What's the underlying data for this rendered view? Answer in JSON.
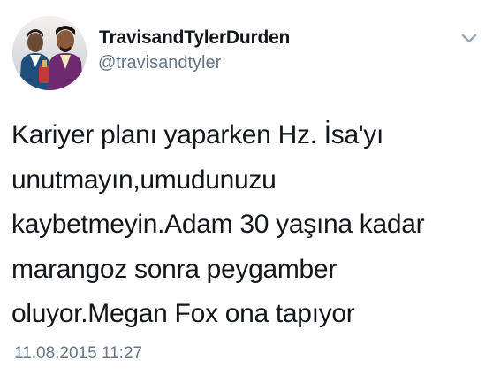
{
  "tweet": {
    "display_name": "TravisandTylerDurden",
    "handle": "@travisandtyler",
    "body": "Kariyer planı yaparken Hz. İsa'yı\nunutmayın,umudunuzu\nkaybetmeyin.Adam 30 yaşına kadar\nmarangoz sonra peygamber\noluyor.Megan Fox ona tapıyor",
    "timestamp": "11.08.2015 11:27",
    "menu_icon": "chevron-down-icon"
  },
  "colors": {
    "text": "#14171a",
    "secondary_text": "#657786",
    "chevron": "#9aa5b1",
    "background": "#ffffff"
  }
}
